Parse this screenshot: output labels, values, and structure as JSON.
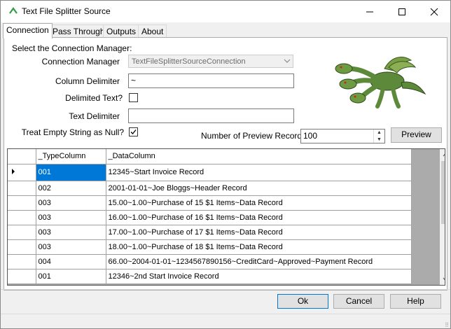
{
  "window": {
    "title": "Text File Splitter Source",
    "controls": {
      "minimize": "–",
      "maximize": "☐",
      "close": "✕"
    }
  },
  "tabs": [
    {
      "label": "Connection",
      "active": true
    },
    {
      "label": "Pass Through",
      "active": false
    },
    {
      "label": "Outputs",
      "active": false
    },
    {
      "label": "About",
      "active": false
    }
  ],
  "form": {
    "section_label": "Select the Connection Manager:",
    "connection_manager": {
      "label": "Connection Manager",
      "value": "TextFileSplitterSourceConnection"
    },
    "column_delimiter": {
      "label": "Column Delimiter",
      "value": "~"
    },
    "delimited_text": {
      "label": "Delimited Text?",
      "checked": false
    },
    "text_delimiter": {
      "label": "Text Delimiter",
      "value": ""
    },
    "treat_empty_null": {
      "label": "Treat Empty String as Null?",
      "checked": true
    },
    "preview_records": {
      "label": "Number of Preview Records",
      "value": "100"
    },
    "preview_button": "Preview"
  },
  "grid": {
    "columns": [
      "_TypeColumn",
      "_DataColumn"
    ],
    "rows": [
      {
        "type": "001",
        "data": "12345~Start Invoice Record"
      },
      {
        "type": "002",
        "data": "2001-01-01~Joe Bloggs~Header Record"
      },
      {
        "type": "003",
        "data": "15.00~1.00~Purchase of 15 $1 Items~Data Record"
      },
      {
        "type": "003",
        "data": "16.00~1.00~Purchase of 16 $1 Items~Data Record"
      },
      {
        "type": "003",
        "data": "17.00~1.00~Purchase of 17 $1 Items~Data Record"
      },
      {
        "type": "003",
        "data": "18.00~1.00~Purchase of 18 $1 Items~Data Record"
      },
      {
        "type": "004",
        "data": "66.00~2004-01-01~1234567890156~CreditCard~Approved~Payment Record"
      },
      {
        "type": "001",
        "data": "12346~2nd Start Invoice Record"
      }
    ]
  },
  "footer": {
    "ok": "Ok",
    "cancel": "Cancel",
    "help": "Help"
  },
  "colors": {
    "accent": "#0078d7",
    "dragon_green": "#5d8a3a"
  }
}
